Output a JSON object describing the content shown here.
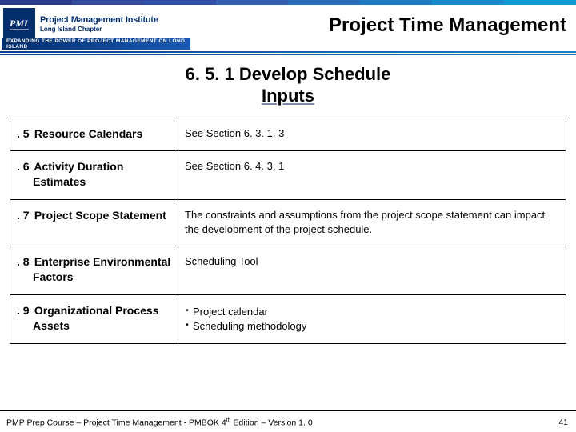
{
  "header": {
    "logo_org_line1": "Project Management Institute",
    "logo_org_line2": "Long Island Chapter",
    "tagline": "EXPANDING THE POWER OF PROJECT MANAGEMENT ON LONG ISLAND",
    "page_title": "Project Time Management"
  },
  "section": {
    "title": "6. 5. 1 Develop Schedule",
    "subtitle": "Inputs"
  },
  "table": {
    "rows": [
      {
        "num": ". 5",
        "label": "Resource Calendars",
        "label_cont": "",
        "desc_text": "See Section 6. 3. 1. 3",
        "desc_bullets": []
      },
      {
        "num": ". 6",
        "label": "Activity Duration",
        "label_cont": "Estimates",
        "desc_text": "See Section 6. 4. 3. 1",
        "desc_bullets": []
      },
      {
        "num": ". 7",
        "label": "Project Scope Statement",
        "label_cont": "",
        "desc_text": "The constraints and assumptions from the project scope statement can impact the development of the project schedule.",
        "desc_bullets": []
      },
      {
        "num": ". 8",
        "label": "Enterprise Environmental",
        "label_cont": "Factors",
        "desc_text": "Scheduling Tool",
        "desc_bullets": []
      },
      {
        "num": ". 9",
        "label": "Organizational Process",
        "label_cont": "Assets",
        "desc_text": "",
        "desc_bullets": [
          "Project calendar",
          "Scheduling methodology"
        ]
      }
    ]
  },
  "footer": {
    "text_pre": "PMP Prep Course – Project Time Management - PMBOK 4",
    "text_sup": "th",
    "text_post": " Edition – Version 1. 0",
    "page_number": "41"
  }
}
